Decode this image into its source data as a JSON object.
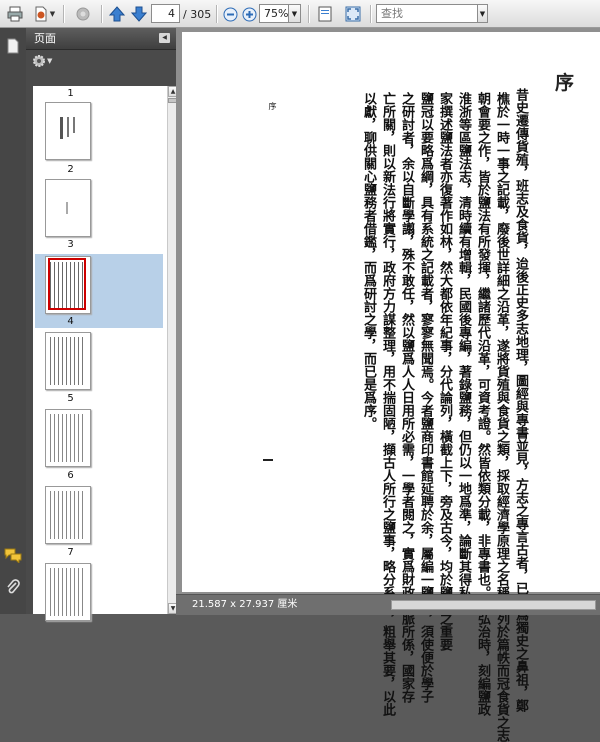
{
  "toolbar": {
    "page_current": "4",
    "page_total": "/ 305",
    "zoom": "75%",
    "search_placeholder": "查找"
  },
  "panel": {
    "title": "页面"
  },
  "thumbnails": [
    "1",
    "2",
    "3",
    "4",
    "5",
    "6",
    "7"
  ],
  "selected_page": "4",
  "document": {
    "title": "序",
    "columns": [
      "昔史遷傳貨殖，班志及食貨，迨後正史多志地理，圖經與專書並見，方志之專言古者，已推爲獨史之鼻祖，鄭",
      "樵於一時一事之記載，廢後世詳細之沿革，遂將貨殖與食貨之類，採取經濟學原理之名稱，列於篇帙而冠食貨之志",
      "朝會要之作，皆於鹽法有所發揮，繼諸歷代沿革，可資考證。然皆依類分載，非專書也。明弘治時，刻編鹽政",
      "淮浙等區鹽法志，清時續有增輯，民國後專編，著錄鹽務，但仍以一地爲準，論斷其得私",
      "家撰述鹽法者亦復著作如林，然大都依年紀事，分代論列，橫截上下，旁及古今，均於鹽政之重要",
      "鹽冠以要略爲綱，具有系統之記載者，寥寥無聞焉。今者鹽商印書館延聘於余，屬編一鹽史，須使便於學子",
      "之研討者，余以自斷學譾，殊不敢任，然以鹽爲人人日用所必需，一學者閱之，實爲財政命脈所係，國家存",
      "亡所關，則以新法行將實行，政府方力謀整理，用不揣固陋，擷古人所行之鹽事，略分系統，粗舉其要，以此",
      "以獻，聊供關心鹽務者借鑑，而爲研討之學，而已是爲序。"
    ],
    "margin_label": "序"
  },
  "status": {
    "page_size": "21.587 x 27.937 厘米"
  }
}
